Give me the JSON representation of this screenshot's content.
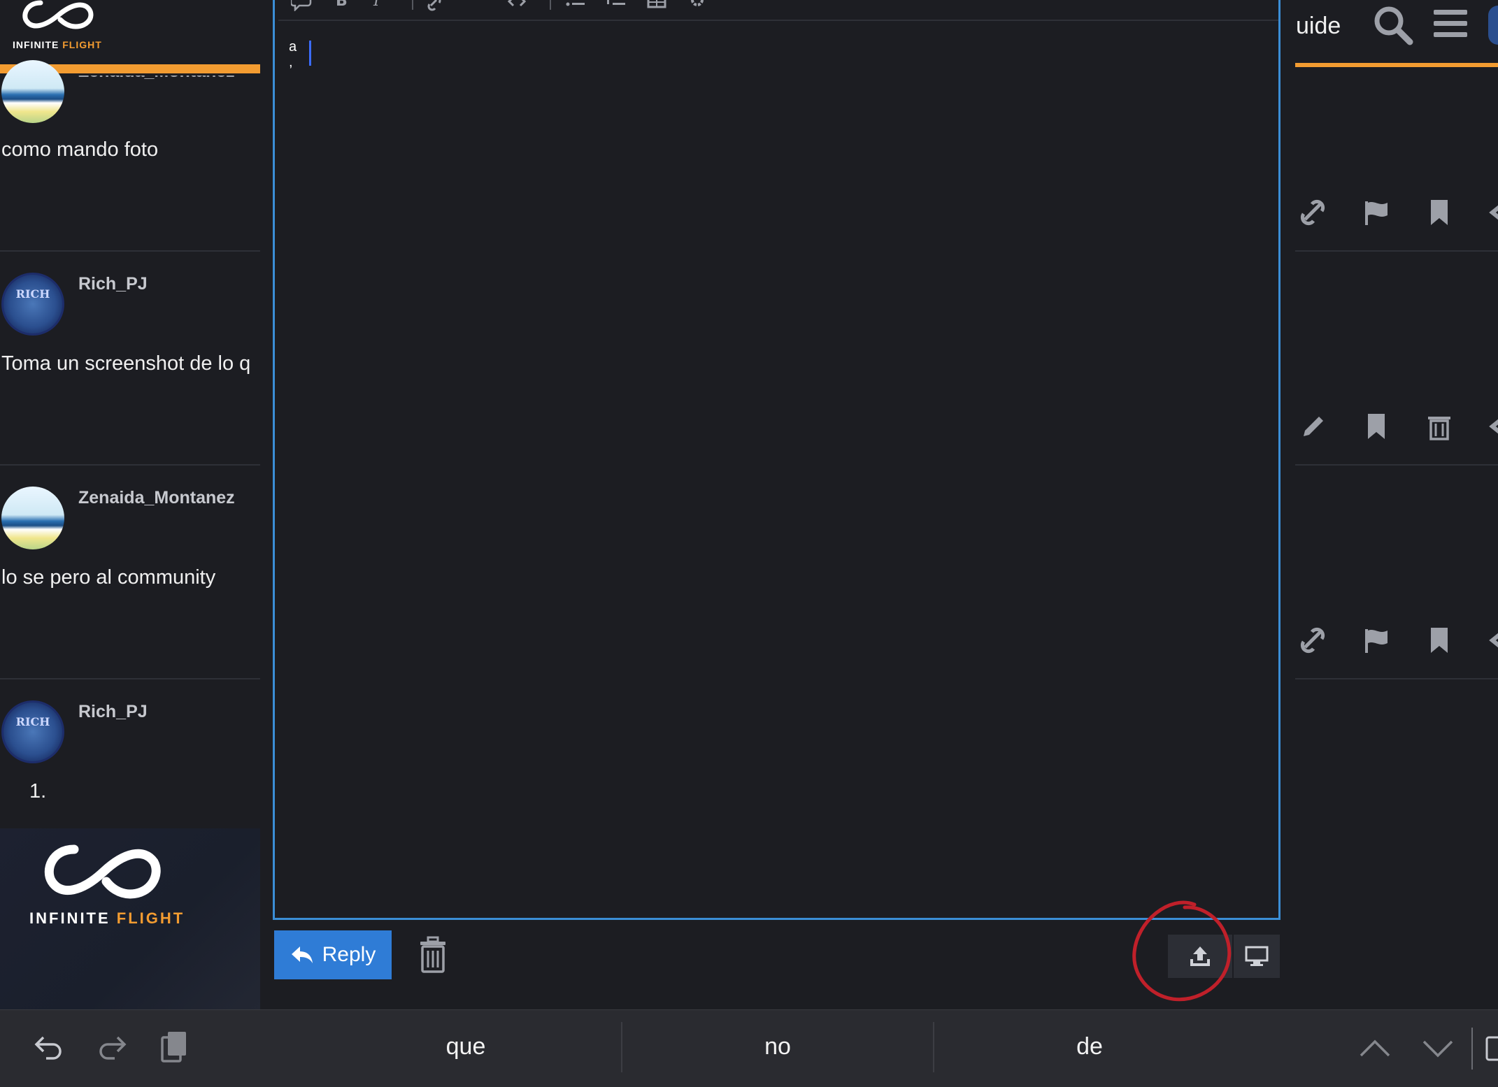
{
  "left": {
    "brand": {
      "word1": "INFINITE",
      "word2": "FLIGHT"
    },
    "posts": [
      {
        "user": "Zenaida_Montanez",
        "text": "como mando foto"
      },
      {
        "user": "Rich_PJ",
        "avatar_text": "RICH",
        "text": "Toma un screenshot de lo q"
      },
      {
        "user": "Zenaida_Montanez",
        "text": "lo se pero al community"
      },
      {
        "user": "Rich_PJ",
        "avatar_text": "RICH",
        "text": "1."
      }
    ],
    "footer_brand": {
      "word1": "INFINITE",
      "word2": "FLIGHT"
    }
  },
  "editor": {
    "content": "a\n,"
  },
  "actions": {
    "reply_label": "Reply"
  },
  "right": {
    "title_fragment": "uide"
  },
  "keyboard": {
    "suggestions": [
      "que",
      "no",
      "de"
    ]
  },
  "colors": {
    "background": "#1c1d22",
    "accent_orange": "#f39c31",
    "primary_blue": "#2f7cd6",
    "editor_border": "#3b8ed6",
    "annotation_red": "#c0202a"
  }
}
